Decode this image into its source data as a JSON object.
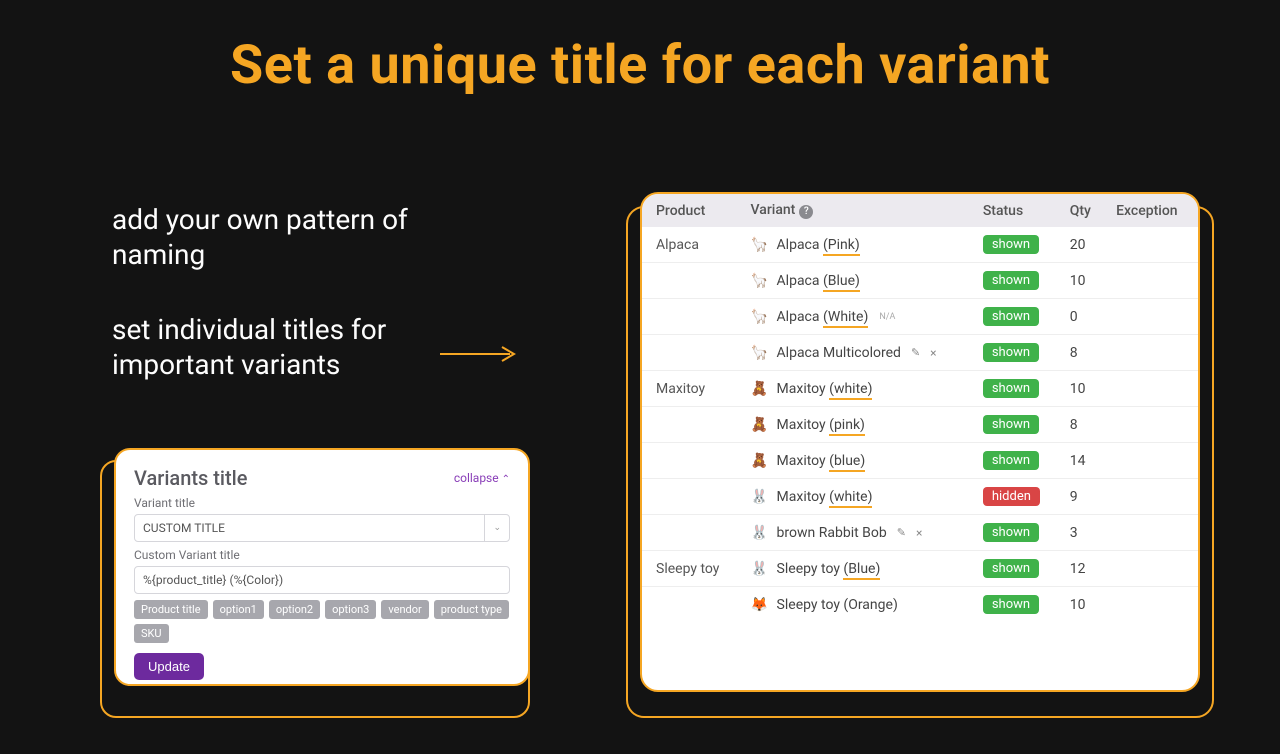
{
  "headline": "Set a unique title for each variant",
  "subhead1": "add your own pattern of naming",
  "subhead2": "set individual titles for important variants",
  "leftPanel": {
    "title": "Variants title",
    "collapse": "collapse",
    "variantTitleLabel": "Variant title",
    "variantTitleValue": "CUSTOM TITLE",
    "customLabel": "Custom Variant title",
    "customValue": "%{product_title} (%{Color})",
    "tags": [
      "Product title",
      "option1",
      "option2",
      "option3",
      "vendor",
      "product type",
      "SKU"
    ],
    "updateLabel": "Update"
  },
  "table": {
    "headers": {
      "product": "Product",
      "variant": "Variant",
      "status": "Status",
      "qty": "Qty",
      "exception": "Exception"
    },
    "groups": [
      {
        "product": "Alpaca",
        "rows": [
          {
            "emoji": "🦙",
            "pre": "Alpaca ",
            "ul": "(Pink)",
            "post": "",
            "status": "shown",
            "qty": "20",
            "na": false,
            "edit": false
          },
          {
            "emoji": "🦙",
            "pre": "Alpaca ",
            "ul": "(Blue)",
            "post": "",
            "status": "shown",
            "qty": "10",
            "na": false,
            "edit": false
          },
          {
            "emoji": "🦙",
            "pre": "Alpaca ",
            "ul": "(White)",
            "post": "",
            "status": "shown",
            "qty": "0",
            "na": true,
            "edit": false
          },
          {
            "emoji": "🦙",
            "pre": "Alpaca Multicolored",
            "ul": "",
            "post": "",
            "status": "shown",
            "qty": "8",
            "na": false,
            "edit": true
          }
        ]
      },
      {
        "product": "Maxitoy",
        "rows": [
          {
            "emoji": "🧸",
            "pre": "Maxitoy ",
            "ul": "(white)",
            "post": "",
            "status": "shown",
            "qty": "10",
            "na": false,
            "edit": false
          },
          {
            "emoji": "🧸",
            "pre": "Maxitoy ",
            "ul": "(pink)",
            "post": "",
            "status": "shown",
            "qty": "8",
            "na": false,
            "edit": false
          },
          {
            "emoji": "🧸",
            "pre": "Maxitoy ",
            "ul": "(blue)",
            "post": "",
            "status": "shown",
            "qty": "14",
            "na": false,
            "edit": false
          },
          {
            "emoji": "🐰",
            "pre": "Maxitoy ",
            "ul": "(white)",
            "post": "",
            "status": "hidden",
            "qty": "9",
            "na": false,
            "edit": false
          },
          {
            "emoji": "🐰",
            "pre": "brown Rabbit Bob",
            "ul": "",
            "post": "",
            "status": "shown",
            "qty": "3",
            "na": false,
            "edit": true
          }
        ]
      },
      {
        "product": "Sleepy toy",
        "rows": [
          {
            "emoji": "🐰",
            "pre": "Sleepy toy ",
            "ul": "(Blue)",
            "post": "",
            "status": "shown",
            "qty": "12",
            "na": false,
            "edit": false
          },
          {
            "emoji": "🦊",
            "pre": "Sleepy toy (Orange)",
            "ul": "",
            "post": "",
            "status": "shown",
            "qty": "10",
            "na": false,
            "edit": false
          }
        ]
      }
    ]
  }
}
